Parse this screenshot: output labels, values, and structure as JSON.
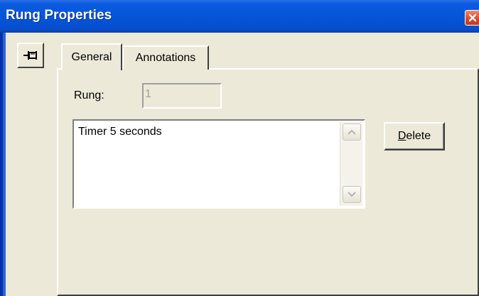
{
  "window": {
    "title": "Rung Properties"
  },
  "tabs": [
    {
      "label": "General",
      "active": true
    },
    {
      "label": "Annotations",
      "active": false
    }
  ],
  "general": {
    "rung_label": "Rung:",
    "rung_value": "1",
    "annotation_text": "Timer 5 seconds",
    "delete_button": {
      "accel": "D",
      "rest": "elete"
    }
  },
  "icons": {
    "pin": "pin-icon",
    "close": "close-icon",
    "scroll_up": "chevron-up-icon",
    "scroll_down": "chevron-down-icon"
  },
  "colors": {
    "titlebar": "#0555d8",
    "dialog_bg": "#ece9d8",
    "close_button": "#d8472a"
  }
}
